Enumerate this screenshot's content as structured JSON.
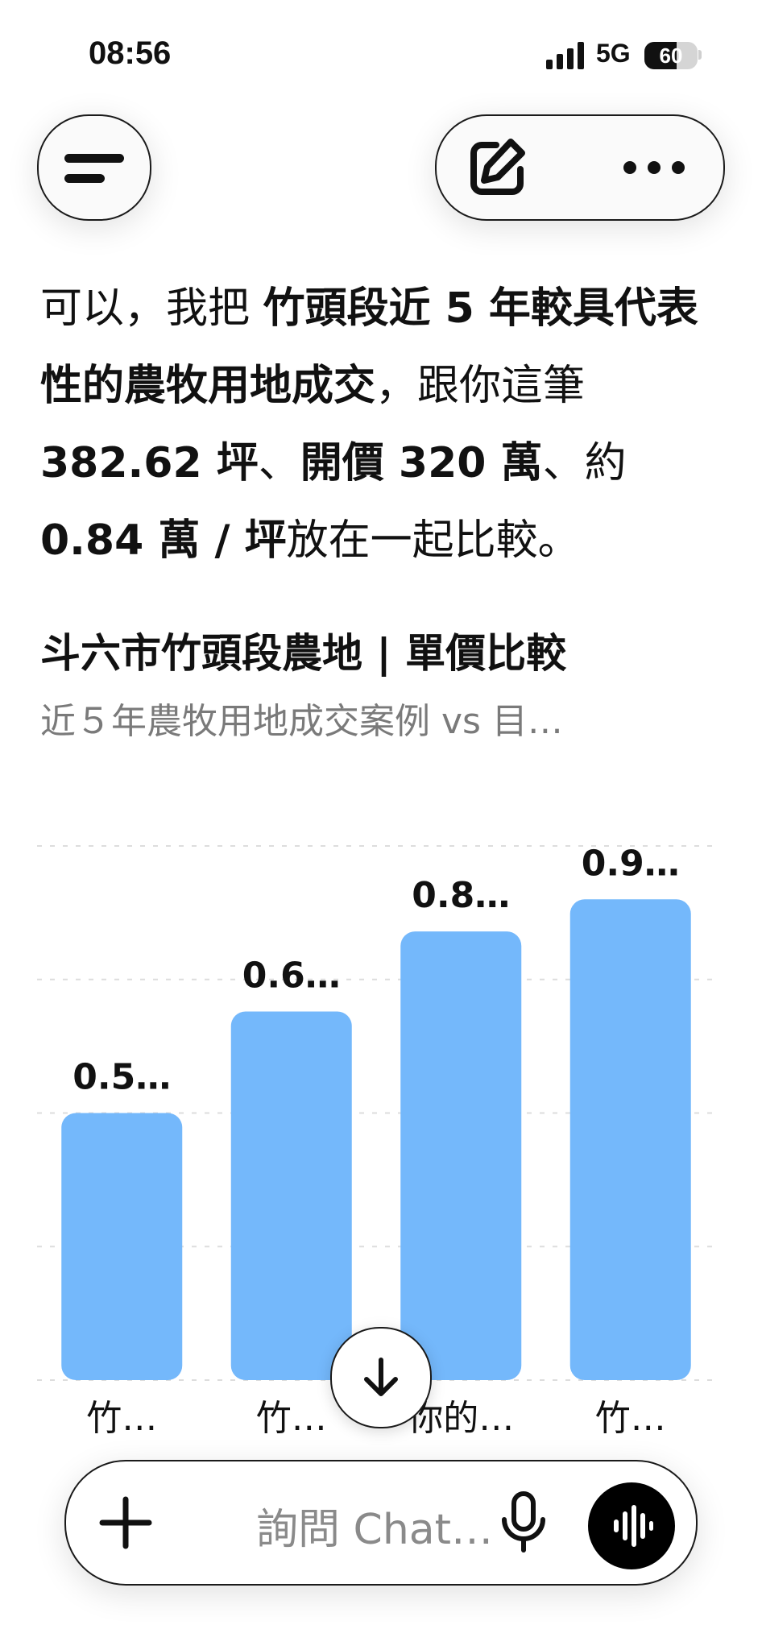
{
  "status_bar": {
    "time": "08:56",
    "network": "5G",
    "battery": "60",
    "battery_level": 0.6
  },
  "header": {
    "menu_icon": "menu-icon",
    "compose_icon": "edit-icon",
    "more_icon": "more-icon"
  },
  "message": {
    "parts": [
      {
        "text": "可以，我把 ",
        "bold": false
      },
      {
        "text": "竹頭段近 5 年較具代表性的農牧用地成交",
        "bold": true
      },
      {
        "text": "，跟你這筆 ",
        "bold": false
      },
      {
        "text": "382.62 坪",
        "bold": true
      },
      {
        "text": "、",
        "bold": false
      },
      {
        "text": "開價 320 萬",
        "bold": true
      },
      {
        "text": "、約 ",
        "bold": false
      },
      {
        "text": "0.84 萬 / 坪",
        "bold": true
      },
      {
        "text": "放在一起比較。",
        "bold": false
      }
    ]
  },
  "chart_title": "斗六市竹頭段農地 | 單價比較",
  "chart_subtitle": "近５年農牧用地成交案例 vs 目…",
  "chart_data": {
    "type": "bar",
    "categories": [
      "竹…",
      "竹…",
      "你的…",
      "竹…"
    ],
    "values": [
      0.5,
      0.69,
      0.84,
      0.9
    ],
    "value_labels": [
      "0.5…",
      "0.6…",
      "0.8…",
      "0.9…"
    ],
    "ylim": [
      0,
      1.0
    ],
    "grid": true,
    "color": "#74b8fb"
  },
  "composer": {
    "placeholder": "詢問 Chat…",
    "add_icon": "plus-icon",
    "mic_icon": "mic-icon",
    "voice_icon": "voice-mode-icon"
  },
  "scroll_icon": "arrow-down-icon"
}
